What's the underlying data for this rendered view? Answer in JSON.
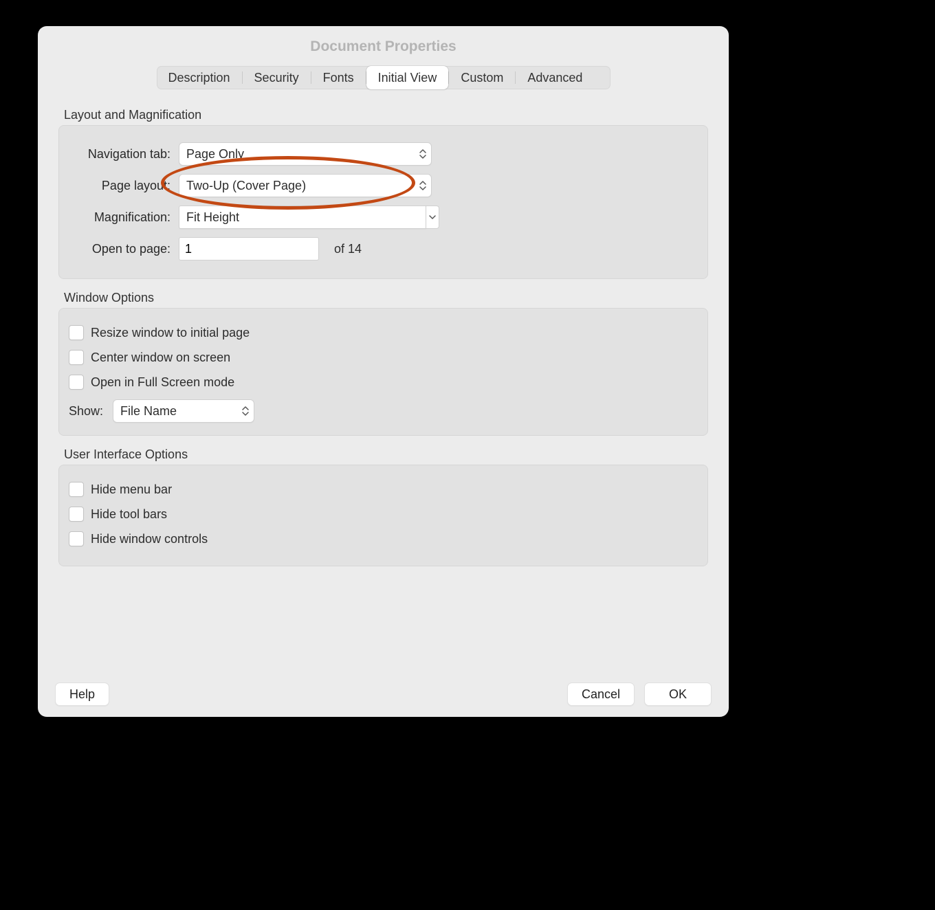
{
  "title": "Document Properties",
  "tabs": [
    "Description",
    "Security",
    "Fonts",
    "Initial View",
    "Custom",
    "Advanced"
  ],
  "active_tab": 3,
  "section1": {
    "title": "Layout and Magnification",
    "nav_label": "Navigation tab:",
    "nav_value": "Page Only",
    "layout_label": "Page layout:",
    "layout_value": "Two-Up (Cover Page)",
    "mag_label": "Magnification:",
    "mag_value": "Fit Height",
    "open_label": "Open to page:",
    "open_value": "1",
    "of_label": "of 14"
  },
  "section2": {
    "title": "Window Options",
    "cb1": "Resize window to initial page",
    "cb2": "Center window on screen",
    "cb3": "Open in Full Screen mode",
    "show_label": "Show:",
    "show_value": "File Name"
  },
  "section3": {
    "title": "User Interface Options",
    "cb1": "Hide menu bar",
    "cb2": "Hide tool bars",
    "cb3": "Hide window controls"
  },
  "buttons": {
    "help": "Help",
    "cancel": "Cancel",
    "ok": "OK"
  }
}
